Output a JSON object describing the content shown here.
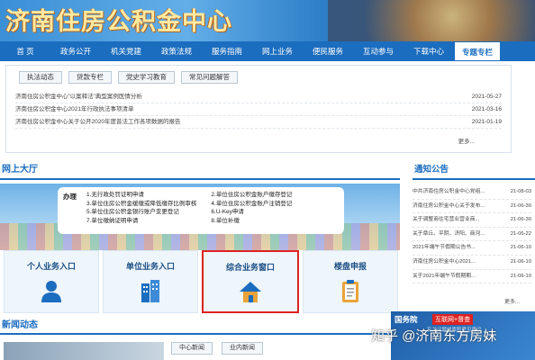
{
  "header": {
    "title": "济南住房公积金中心"
  },
  "nav": {
    "items": [
      {
        "label": "首 页"
      },
      {
        "label": "政务公开"
      },
      {
        "label": "机关党建"
      },
      {
        "label": "政策法规"
      },
      {
        "label": "服务指南"
      },
      {
        "label": "网上业务"
      },
      {
        "label": "便民服务"
      },
      {
        "label": "互动参与"
      },
      {
        "label": "下载中心"
      },
      {
        "label": "专题专栏"
      }
    ],
    "active_index": 9
  },
  "special": {
    "tabs": [
      {
        "label": "执法动态"
      },
      {
        "label": "贷款专栏"
      },
      {
        "label": "党史学习教育"
      },
      {
        "label": "常见问题解答"
      }
    ],
    "news": [
      {
        "title": "济南住房公积金中心“以案释法”典型案例医情分析",
        "date": "2021-05-27"
      },
      {
        "title": "济南住房公积金中心2021年行政执法事项清单",
        "date": "2021-03-16"
      },
      {
        "title": "济南住房公积金中心关于公开2020年度普法工作各项数据的报告",
        "date": "2021-01-19"
      }
    ],
    "more": "更多..."
  },
  "hall": {
    "title": "网上大厅",
    "todo_label": "办理",
    "items_left": [
      "1.无行政处罚证明申请",
      "3.单位住房公积金缓缴或降低缴存比例审核",
      "5.单位住房公积金银行账户变更登记",
      "7.单位缴纳证明申请"
    ],
    "items_right": [
      "2.单位住房公积金账户缴存登记",
      "4.单位住房公积金账户注销登记",
      "6.U-Key申请",
      "8.单位补缴"
    ],
    "cards": [
      {
        "label": "个人业务入口",
        "icon": "person-icon"
      },
      {
        "label": "单位业务入口",
        "icon": "building-icon"
      },
      {
        "label": "综合业务窗口",
        "icon": "house-icon"
      },
      {
        "label": "楼盘申报",
        "icon": "clipboard-icon"
      }
    ],
    "highlight_index": 2
  },
  "notice": {
    "title": "通知公告",
    "items": [
      {
        "title": "中共济南住房公积金中心党组...",
        "date": "21-08-03"
      },
      {
        "title": "济南住房公积金中心关于发布...",
        "date": "21-06-30"
      },
      {
        "title": "关于调整商住宅营业营业商...",
        "date": "21-06-30"
      },
      {
        "title": "关于章丘、平阴、济阳、商河...",
        "date": "21-06-22"
      },
      {
        "title": "2021年端午节假期公告书...",
        "date": "21-06-10"
      },
      {
        "title": "济南住房公积金中心2021...",
        "date": "21-06-10"
      },
      {
        "title": "关于2021年端午节假期期...",
        "date": "21-06-10"
      }
    ],
    "more": "更多..."
  },
  "news": {
    "title": "新闻动态",
    "tabs": [
      {
        "label": "中心新闻"
      },
      {
        "label": "业内新闻"
      }
    ]
  },
  "council": {
    "name": "国务院",
    "badge": "互联网+督查",
    "sub": "有关问题线索和意见建议"
  },
  "watermark": "知乎 @济南东方房妹",
  "colors": {
    "nav": "#1b6dbf",
    "highlight_border": "#dd2222",
    "title_text": "#ffe9a0"
  }
}
